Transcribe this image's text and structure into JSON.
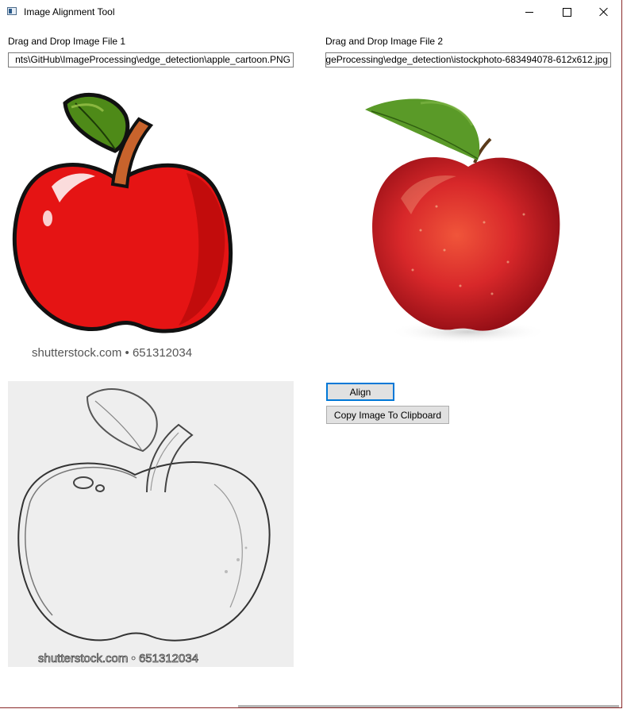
{
  "window": {
    "title": "Image Alignment Tool"
  },
  "controls": {
    "minimize": "minimize",
    "maximize": "maximize",
    "close": "close"
  },
  "file1": {
    "label": "Drag and Drop Image File 1",
    "path": "nts\\GitHub\\ImageProcessing\\edge_detection\\apple_cartoon.PNG"
  },
  "file2": {
    "label": "Drag and Drop Image File 2",
    "path": "geProcessing\\edge_detection\\istockphoto-683494078-612x612.jpg"
  },
  "images": {
    "cartoon_watermark": "shutterstock.com • 651312034",
    "edge_watermark": "shutterstock.com • 651312034"
  },
  "buttons": {
    "align": "Align",
    "copy": "Copy Image To Clipboard"
  },
  "colors": {
    "focus_border": "#0078d7",
    "button_bg": "#e1e1e1",
    "apple_red": "#e21212",
    "leaf_green": "#4e8a18"
  }
}
